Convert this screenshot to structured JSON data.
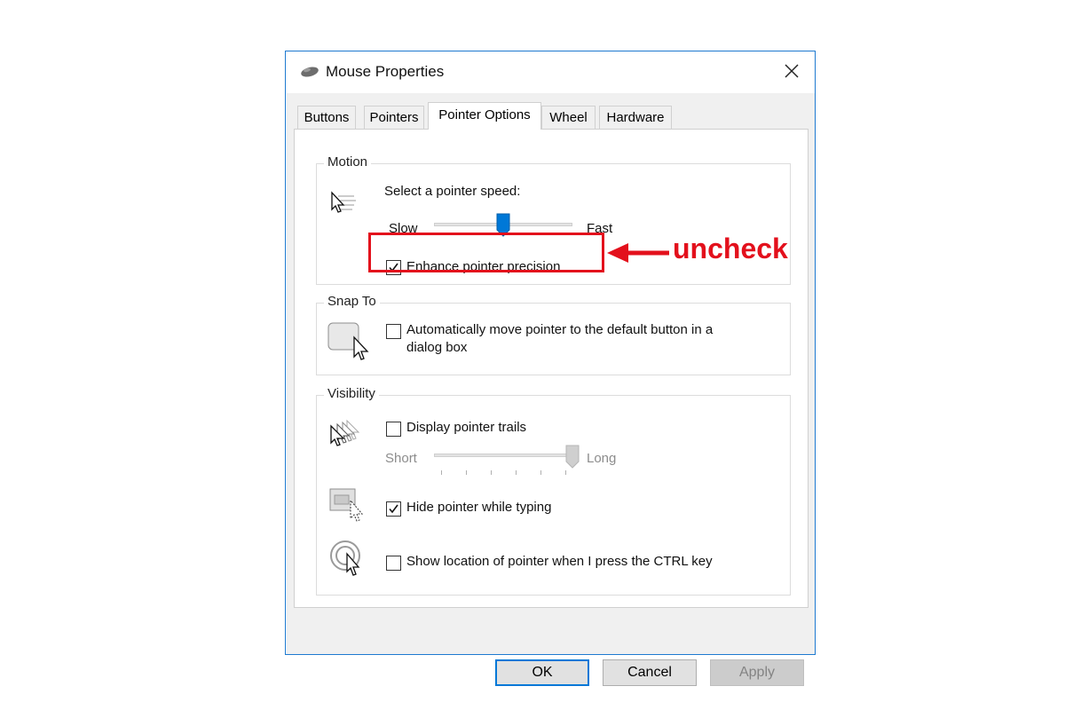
{
  "window": {
    "title": "Mouse Properties",
    "icon": "mouse-icon",
    "close_icon": "close-icon"
  },
  "tabs": [
    {
      "label": "Buttons",
      "active": false
    },
    {
      "label": "Pointers",
      "active": false
    },
    {
      "label": "Pointer Options",
      "active": true
    },
    {
      "label": "Wheel",
      "active": false
    },
    {
      "label": "Hardware",
      "active": false
    }
  ],
  "motion": {
    "title": "Motion",
    "speed_label": "Select a pointer speed:",
    "slow_label": "Slow",
    "fast_label": "Fast",
    "speed_value": 0.5,
    "precision_label": "Enhance pointer precision",
    "precision_checked": true
  },
  "snap_to": {
    "title": "Snap To",
    "label_line1": "Automatically move pointer to the default button in a",
    "label_line2": "dialog box",
    "checked": false
  },
  "visibility": {
    "title": "Visibility",
    "trails_label": "Display pointer trails",
    "trails_checked": false,
    "short_label": "Short",
    "long_label": "Long",
    "trails_value": 1.0,
    "hide_label": "Hide pointer while typing",
    "hide_checked": true,
    "ctrl_label": "Show location of pointer when I press the CTRL key",
    "ctrl_checked": false
  },
  "buttons": {
    "ok": "OK",
    "cancel": "Cancel",
    "apply": "Apply"
  },
  "annotation": {
    "text": "uncheck",
    "color": "#e3101c"
  },
  "colors": {
    "accent": "#0078d7",
    "window_border": "#1e7ad0"
  }
}
